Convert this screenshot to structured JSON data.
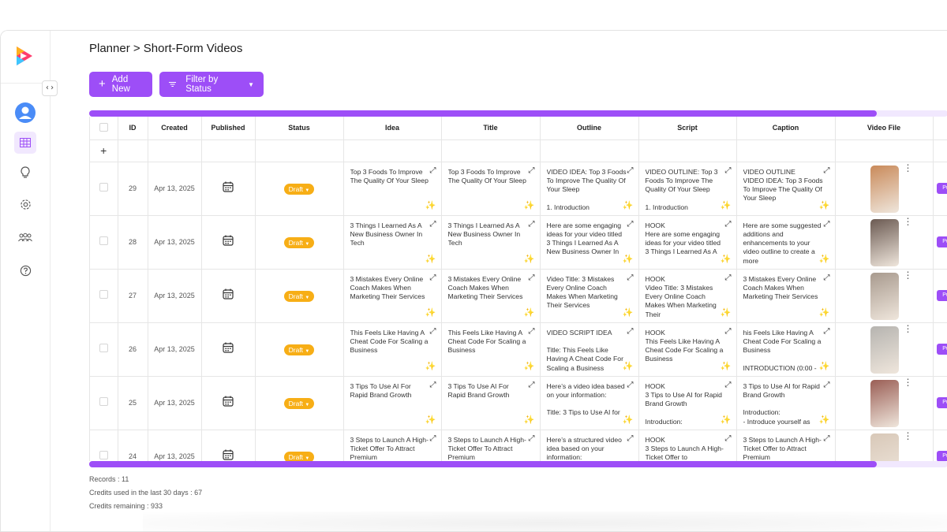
{
  "breadcrumb": "Planner > Short-Form Videos",
  "toolbar": {
    "add_label": "Add New",
    "filter_label": "Filter by Status"
  },
  "columns": [
    "ID",
    "Created",
    "Published",
    "Status",
    "Idea",
    "Title",
    "Outline",
    "Script",
    "Caption",
    "Video File"
  ],
  "rows": [
    {
      "id": "29",
      "created": "Apr 13, 2025",
      "status": "Draft",
      "idea": "Top 3 Foods To Improve The Quality Of Your Sleep",
      "title": "Top 3 Foods To Improve The Quality Of Your Sleep",
      "outline": "VIDEO IDEA: Top 3 Foods To Improve The Quality Of Your Sleep\n\n1. Introduction",
      "script": "VIDEO OUTLINE: Top 3 Foods To Improve The Quality Of Your Sleep\n\n1. Introduction",
      "caption": "VIDEO OUTLINE\nVIDEO IDEA: Top 3 Foods To Improve The Quality Of Your Sleep",
      "thumb_color": "#c98a5a"
    },
    {
      "id": "28",
      "created": "Apr 13, 2025",
      "status": "Draft",
      "idea": "3 Things I Learned As A New Business Owner In Tech",
      "title": "3 Things I Learned As A New Business Owner In Tech",
      "outline": "Here are some engaging ideas for your video titled 3 Things I Learned As A New Business Owner In",
      "script": "HOOK\nHere are some engaging ideas for your video titled 3 Things I Learned As A",
      "caption": "Here are some suggested additions and enhancements to your video outline to create a more",
      "thumb_color": "#6b5a52"
    },
    {
      "id": "27",
      "created": "Apr 13, 2025",
      "status": "Draft",
      "idea": "3 Mistakes Every Online Coach Makes When Marketing Their Services",
      "title": "3 Mistakes Every Online Coach Makes When Marketing Their Services",
      "outline": "Video Title: 3 Mistakes Every Online Coach Makes When Marketing Their Services",
      "script": "HOOK\nVideo Title: 3 Mistakes Every Online Coach Makes When Marketing Their",
      "caption": "3 Mistakes Every Online Coach Makes When Marketing Their Services",
      "thumb_color": "#a89a8e"
    },
    {
      "id": "26",
      "created": "Apr 13, 2025",
      "status": "Draft",
      "idea": "This Feels Like Having A Cheat Code For Scaling a Business",
      "title": "This Feels Like Having A Cheat Code For Scaling a Business",
      "outline": "VIDEO SCRIPT IDEA\n\nTitle: This Feels Like Having A Cheat Code For Scaling a Business",
      "script": "HOOK\nThis Feels Like Having A Cheat Code For Scaling a Business",
      "caption": "his Feels Like Having A Cheat Code For Scaling a Business\n\nINTRODUCTION (0:00 -",
      "thumb_color": "#b6b4b0"
    },
    {
      "id": "25",
      "created": "Apr 13, 2025",
      "status": "Draft",
      "idea": "3 Tips To Use AI For Rapid Brand Growth",
      "title": "3 Tips To Use AI For Rapid Brand Growth",
      "outline": "Here’s a video idea based on your information:\n\nTitle: 3 Tips to Use AI for",
      "script": "HOOK\n3 Tips to Use AI for Rapid Brand Growth\n\nIntroduction:",
      "caption": "3 Tips to Use AI for Rapid Brand Growth\n\nIntroduction:\n- Introduce yourself as",
      "thumb_color": "#9a5e55"
    },
    {
      "id": "24",
      "created": "Apr 13, 2025",
      "status": "Draft",
      "idea": "3 Steps to Launch A High-Ticket Offer To Attract Premium",
      "title": "3 Steps to Launch A High-Ticket Offer To Attract Premium",
      "outline": "Here’s a structured video idea based on your information:",
      "script": "HOOK\n3 Steps to Launch A High-Ticket Offer to",
      "caption": "3 Steps to Launch A High-Ticket Offer to Attract Premium",
      "thumb_color": "#d8c8b8"
    }
  ],
  "publish_label": "Pu",
  "footer": {
    "records": "Records : 11",
    "credits_used": "Credits used in the last 30 days : 67",
    "credits_remaining": "Credits remaining : 933"
  },
  "colors": {
    "accent": "#9d4ef7",
    "status_draft": "#f7ae16"
  },
  "icons": [
    "logo-icon",
    "code-toggle-icon",
    "avatar-icon",
    "table-icon",
    "lightbulb-icon",
    "gear-icon",
    "team-icon",
    "help-icon",
    "plus-icon",
    "filter-icon",
    "chevron-down-icon",
    "calendar-icon",
    "expand-icon",
    "magic-wand-icon",
    "kebab-icon"
  ]
}
